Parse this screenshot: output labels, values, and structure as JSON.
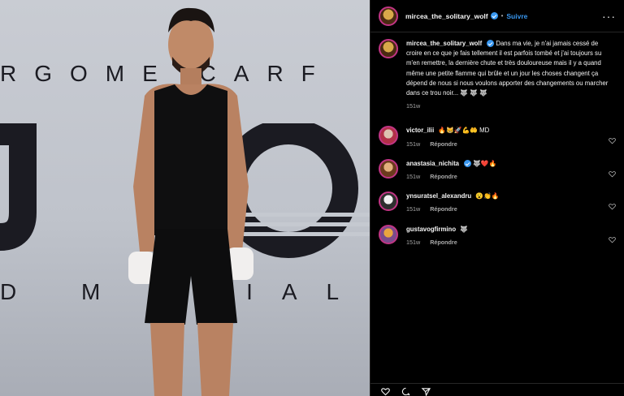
{
  "photo": {
    "backdrop_top_text": "RGOME  CARF",
    "backdrop_bottom_text": "D  M R  IAL"
  },
  "header": {
    "username": "mircea_the_solitary_wolf",
    "separator": "•",
    "follow_label": "Suivre",
    "more_label": "···"
  },
  "caption": {
    "username": "mircea_the_solitary_wolf",
    "text": "Dans ma vie, je n'ai jamais cessé de croire en ce que je fais tellement il est parfois tombé et j'ai toujours su m'en remettre, la dernière chute et très douloureuse mais il y a quand même une petite flamme qui brûle et un jour les choses changent ça dépend de nous si nous voulons apporter des changements ou marcher dans ce trou noir... 🐺 🐺 🐺",
    "time": "151w"
  },
  "comments": [
    {
      "username": "victor_ilii",
      "text": "🔥😸🚀💪🤲 MD",
      "time": "151w",
      "reply_label": "Répondre"
    },
    {
      "username": "anastasia_nichita",
      "text": "🐺❤️🔥",
      "time": "151w",
      "reply_label": "Répondre"
    },
    {
      "username": "ynsuratsel_alexandru",
      "text": "😮👏🔥",
      "time": "151w",
      "reply_label": "Répondre"
    },
    {
      "username": "gustavogfirmino",
      "text": "🐺",
      "time": "151w",
      "reply_label": "Répondre"
    }
  ],
  "icons": {
    "verified": "verified-badge-icon",
    "heart": "heart-icon",
    "comment": "comment-icon",
    "share": "share-icon"
  },
  "colors": {
    "link": "#3897f0",
    "background": "#000000",
    "muted": "#a8a8a8"
  }
}
